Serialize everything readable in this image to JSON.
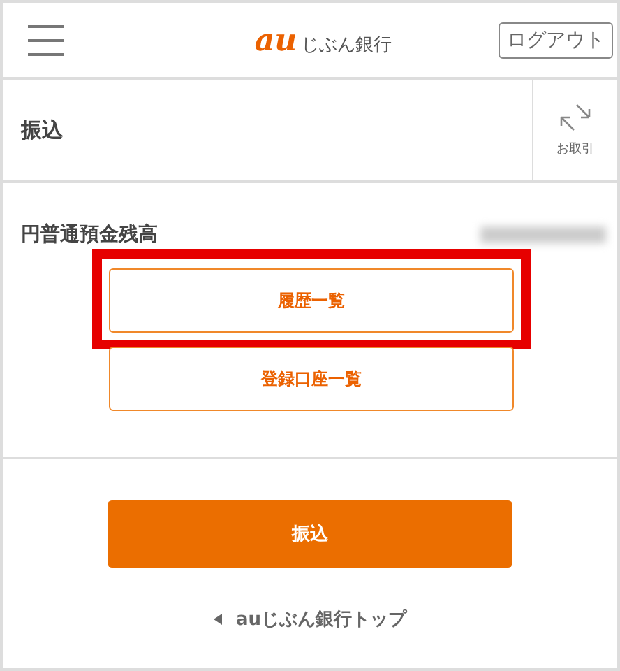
{
  "header": {
    "logo": {
      "mark": "au",
      "name": "じぶん銀行"
    },
    "logout": "ログアウト"
  },
  "title_bar": {
    "title": "振込",
    "action": "お取引"
  },
  "balance": {
    "label": "円普通預金残高",
    "amount_hidden": true
  },
  "list_buttons": [
    {
      "label": "履歴一覧",
      "highlighted": true
    },
    {
      "label": "登録口座一覧",
      "highlighted": false
    }
  ],
  "primary_button": "振込",
  "back_link": "auじぶん銀行トップ"
}
